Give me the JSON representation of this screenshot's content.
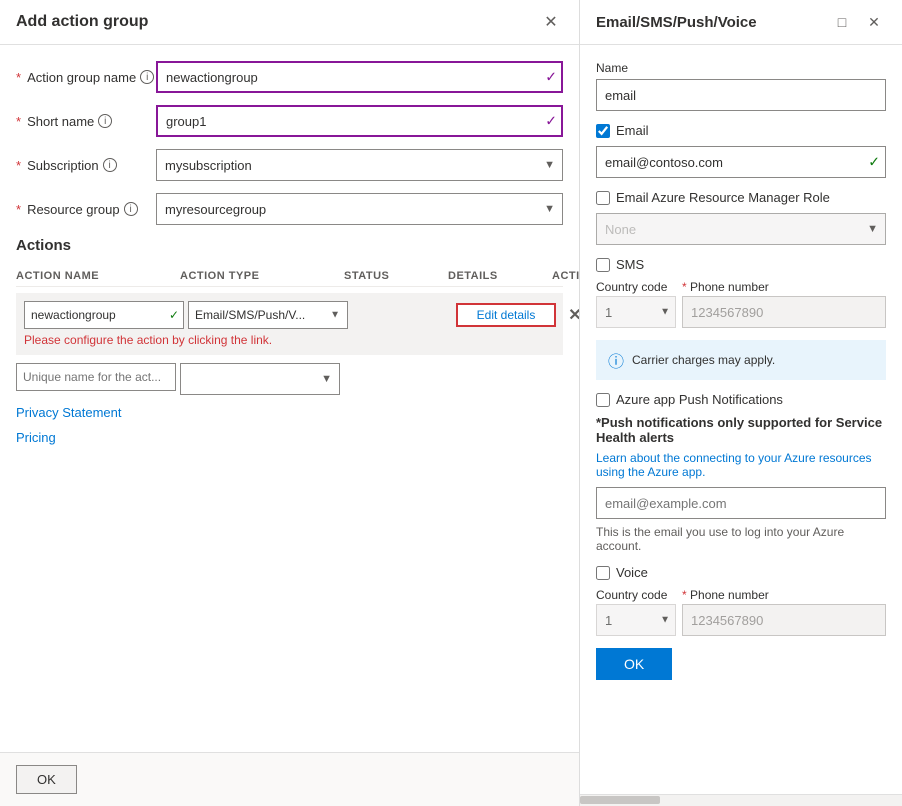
{
  "left_panel": {
    "title": "Add action group",
    "fields": {
      "action_group_name_label": "Action group name",
      "action_group_name_value": "newactiongroup",
      "short_name_label": "Short name",
      "short_name_value": "group1",
      "subscription_label": "Subscription",
      "subscription_value": "mysubscription",
      "resource_group_label": "Resource group",
      "resource_group_value": "myresourcegroup"
    },
    "actions_section": {
      "title": "Actions",
      "columns": {
        "action_name": "ACTION NAME",
        "action_type": "ACTION TYPE",
        "status": "STATUS",
        "details": "DETAILS",
        "actions": "ACTIONS"
      },
      "row": {
        "name_value": "newactiongroup",
        "type_value": "Email/SMS/Push/V...",
        "edit_label": "Edit details",
        "error_text": "Please configure the action by clicking the link."
      },
      "new_row_placeholder": "Unique name for the act..."
    },
    "privacy_link": "Privacy Statement",
    "pricing_link": "Pricing",
    "ok_label": "OK"
  },
  "right_panel": {
    "title": "Email/SMS/Push/Voice",
    "name_label": "Name",
    "name_value": "email",
    "email_checkbox_label": "Email",
    "email_checked": true,
    "email_value": "email@contoso.com",
    "email_azure_role_label": "Email Azure Resource Manager Role",
    "email_azure_role_placeholder": "None",
    "sms_checkbox_label": "SMS",
    "sms_checked": false,
    "sms_country_code_label": "Country code",
    "sms_country_code_value": "1",
    "sms_phone_label": "Phone number",
    "sms_phone_value": "1234567890",
    "carrier_notice": "Carrier charges may apply.",
    "push_checkbox_label": "Azure app Push Notifications",
    "push_checked": false,
    "push_note_bold": "*Push notifications only supported for Service Health alerts",
    "push_link_text": "Learn about the connecting to your Azure resources using the Azure app.",
    "push_email_placeholder": "email@example.com",
    "push_note_small": "This is the email you use to log into your Azure account.",
    "voice_checkbox_label": "Voice",
    "voice_checked": false,
    "voice_country_code_label": "Country code",
    "voice_country_code_value": "1",
    "voice_phone_label": "Phone number",
    "voice_phone_value": "1234567890",
    "ok_label": "OK"
  }
}
